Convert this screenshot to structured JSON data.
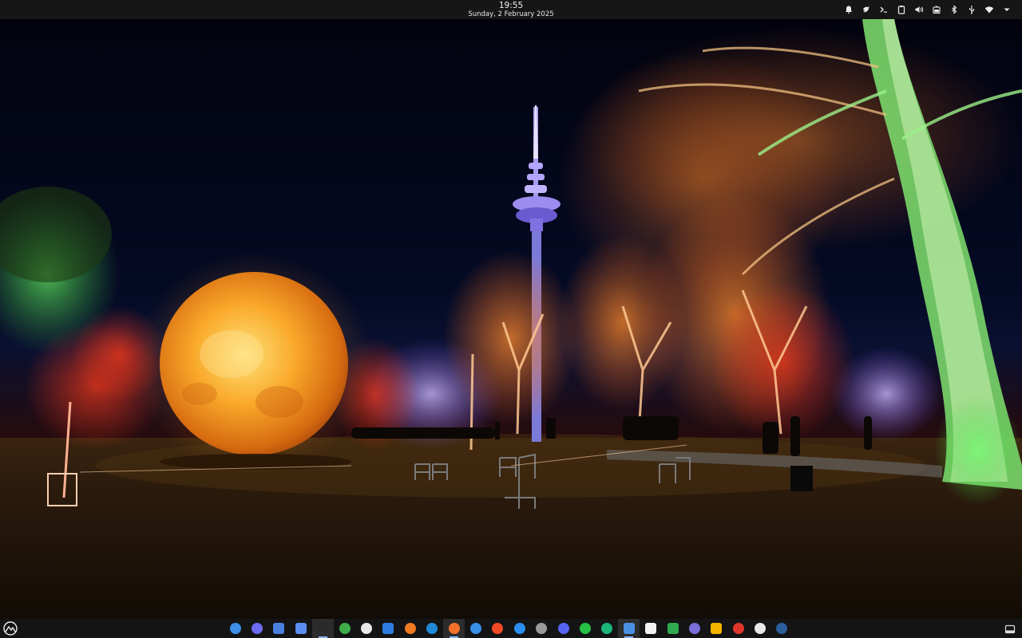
{
  "panel": {
    "time": "19:55",
    "date": "Sunday, 2 February 2025",
    "tray_icons": [
      {
        "name": "notifications-bell-icon"
      },
      {
        "name": "bird-app-icon"
      },
      {
        "name": "terminal-prompt-icon"
      },
      {
        "name": "clipboard-icon"
      },
      {
        "name": "volume-icon"
      },
      {
        "name": "battery-icon"
      },
      {
        "name": "bluetooth-icon"
      },
      {
        "name": "usb-icon"
      },
      {
        "name": "wifi-icon"
      },
      {
        "name": "system-menu-chevron-icon"
      }
    ]
  },
  "dock": {
    "start_icon": "distro-logo-icon",
    "apps": [
      {
        "name": "app-blue-circle-icon",
        "color": "#3d8ee6"
      },
      {
        "name": "app-browser-swirl-icon",
        "color": "#6c6cf0"
      },
      {
        "name": "app-blue-doc-icon",
        "color": "#4a7fe0"
      },
      {
        "name": "files-folder-icon",
        "color": "#5b8def"
      },
      {
        "name": "terminal-icon",
        "color": "#2b2b2b",
        "active": true
      },
      {
        "name": "app-green-leaf-icon",
        "color": "#3fae4a"
      },
      {
        "name": "app-white-circle-icon",
        "color": "#e8e8e8"
      },
      {
        "name": "app-blue-cube-icon",
        "color": "#2f7de1"
      },
      {
        "name": "app-orange-flower-icon",
        "color": "#f07b22"
      },
      {
        "name": "vscode-icon",
        "color": "#1e8ad8"
      },
      {
        "name": "firefox-icon",
        "color": "#f2702a",
        "active": true
      },
      {
        "name": "app-blue-ring-icon",
        "color": "#3a8fe8"
      },
      {
        "name": "brave-browser-icon",
        "color": "#f04a24"
      },
      {
        "name": "app-blue-orb-icon",
        "color": "#2a8ef0"
      },
      {
        "name": "app-grey-shell-icon",
        "color": "#9a9a9a"
      },
      {
        "name": "discord-icon",
        "color": "#5865f2"
      },
      {
        "name": "whatsapp-icon",
        "color": "#26c043"
      },
      {
        "name": "app-green-sync-icon",
        "color": "#1ab67a"
      },
      {
        "name": "app-window-stack-icon",
        "color": "#4a90e2",
        "active": true
      },
      {
        "name": "text-document-icon",
        "color": "#f2f2f2"
      },
      {
        "name": "spreadsheet-icon",
        "color": "#2fa84f"
      },
      {
        "name": "app-elephant-icon",
        "color": "#7a6ed8"
      },
      {
        "name": "slides-presentation-icon",
        "color": "#f4b400"
      },
      {
        "name": "app-red-pin-icon",
        "color": "#e0352b"
      },
      {
        "name": "app-penguin-icon",
        "color": "#e8e8e8"
      },
      {
        "name": "steam-icon",
        "color": "#2a5d9a"
      }
    ],
    "right_icon": "show-desktop-icon"
  },
  "colors": {
    "panel_bg": "#161616",
    "dock_bg": "#141414",
    "accent": "#8ab4f8"
  }
}
